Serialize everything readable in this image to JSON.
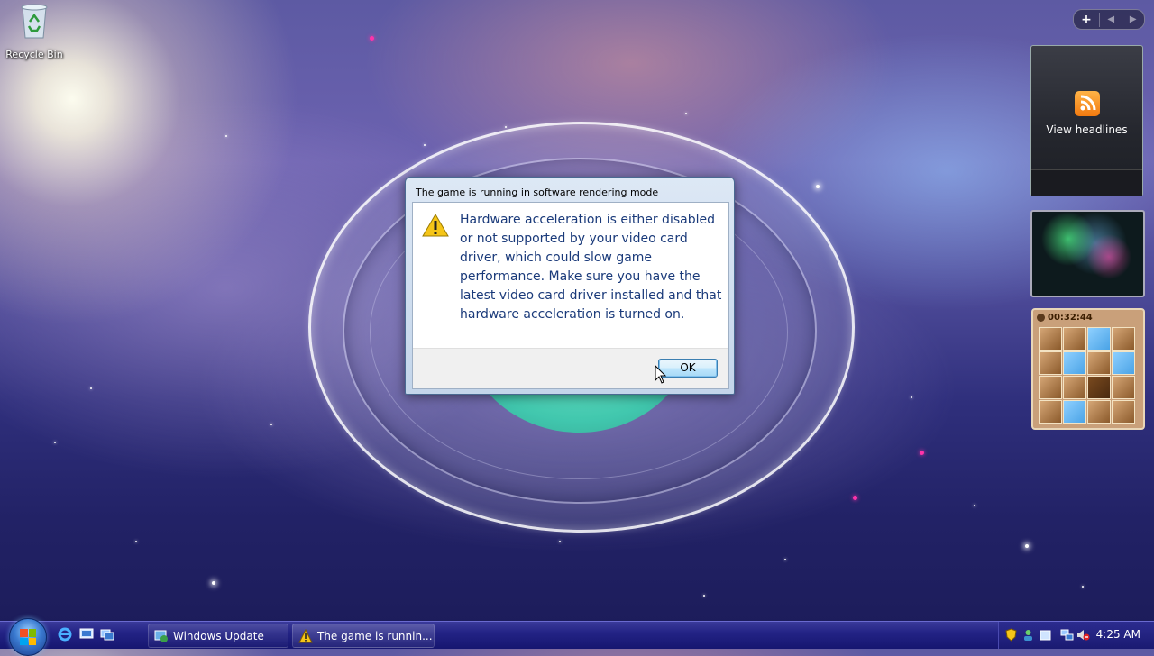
{
  "desktop": {
    "recycle_bin_label": "Recycle Bin"
  },
  "sidebar": {
    "add_gadget": "+",
    "prev": "◀",
    "next": "▶",
    "feed_text": "View headlines",
    "puzzle_timer": "00:32:44"
  },
  "dialog": {
    "title": "The game is running in software rendering mode",
    "message": "Hardware acceleration is either disabled or not supported by your video card driver, which could slow game performance. Make sure you have the latest video card driver installed and that hardware acceleration is turned on.",
    "ok_label": "OK"
  },
  "taskbar": {
    "buttons": [
      {
        "label": "Windows Update"
      },
      {
        "label": "The game is runnin..."
      }
    ],
    "clock": "4:25 AM"
  },
  "colors": {
    "taskbar": "#1a1a72",
    "dialog_text": "#1a3a7a",
    "warning": "#f5c518"
  }
}
